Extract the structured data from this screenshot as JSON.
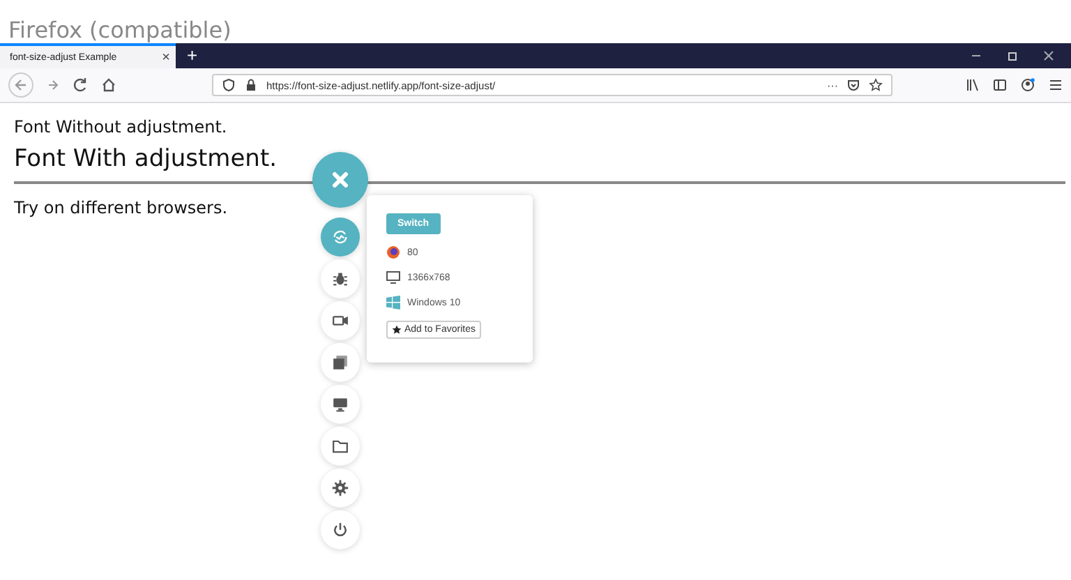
{
  "heading": "Firefox (compatible)",
  "browser": {
    "tab": {
      "title": "font-size-adjust Example",
      "close": "×"
    },
    "new_tab": "+",
    "url": "https://font-size-adjust.netlify.app/font-size-adjust/",
    "page_actions": "···"
  },
  "page": {
    "line_1": "Font Without adjustment.",
    "line_2": "Font With adjustment.",
    "line_3": "Try on different browsers."
  },
  "tool_menu": {
    "items": [
      {
        "kind": "switch",
        "selected": true
      },
      {
        "kind": "bug",
        "selected": false
      },
      {
        "kind": "video",
        "selected": false
      },
      {
        "kind": "screenshots",
        "selected": false
      },
      {
        "kind": "display",
        "selected": false
      },
      {
        "kind": "folder",
        "selected": false
      },
      {
        "kind": "settings",
        "selected": false
      },
      {
        "kind": "power",
        "selected": false
      }
    ]
  },
  "popup": {
    "button": "Switch",
    "browser_version": "80",
    "resolution": "1366x768",
    "os": "Windows 10",
    "favorite": "Add to Favorites"
  }
}
